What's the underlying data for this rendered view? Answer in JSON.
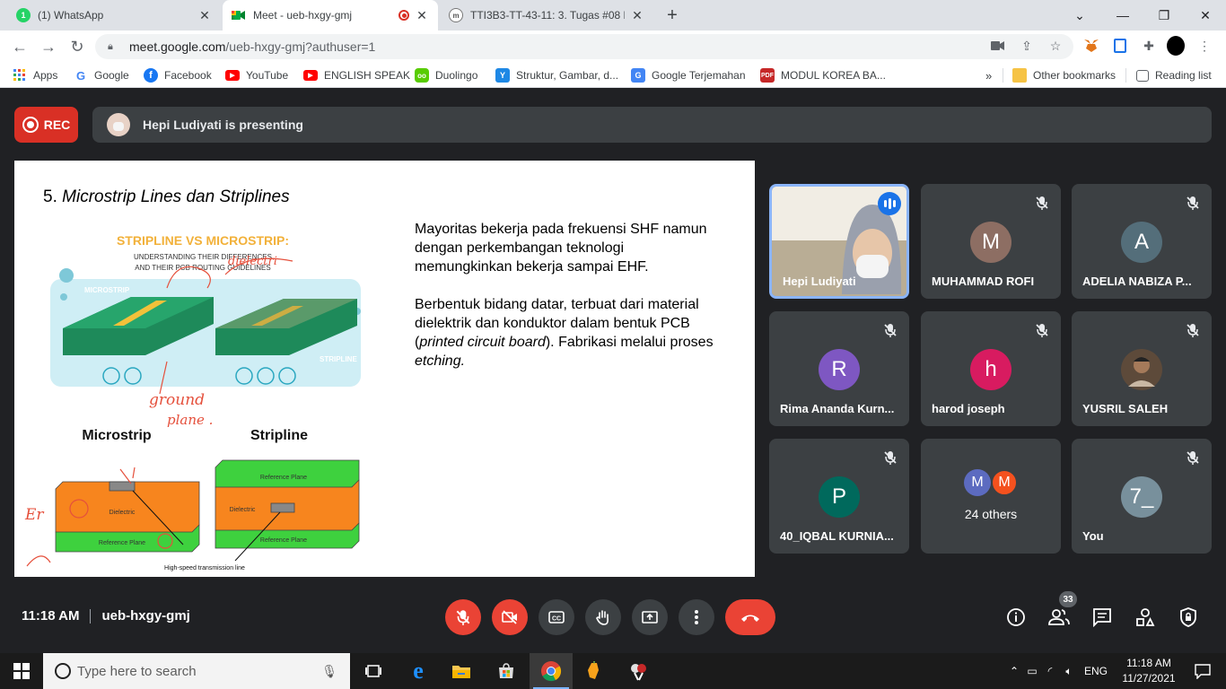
{
  "browser": {
    "tabs": [
      {
        "title": "(1) WhatsApp",
        "icon": "whatsapp-icon"
      },
      {
        "title": "Meet - ueb-hxgy-gmj",
        "icon": "google-meet-icon"
      },
      {
        "title": "TTI3B3-TT-43-11: 3. Tugas #08 P...",
        "icon": "moodle-icon"
      }
    ],
    "new_tab": "+",
    "url_host": "meet.google.com",
    "url_path": "/ueb-hxgy-gmj?authuser=1"
  },
  "bookmarks": [
    {
      "label": "Apps",
      "icon": "apps-grid-icon"
    },
    {
      "label": "Google",
      "icon": "google-icon"
    },
    {
      "label": "Facebook",
      "icon": "facebook-icon"
    },
    {
      "label": "YouTube",
      "icon": "youtube-icon"
    },
    {
      "label": "ENGLISH SPEAK",
      "icon": "youtube-icon"
    },
    {
      "label": "Duolingo",
      "icon": "duolingo-icon"
    },
    {
      "label": "Struktur, Gambar, d...",
      "icon": "yahoo-icon"
    },
    {
      "label": "Google Terjemahan",
      "icon": "translate-icon"
    },
    {
      "label": "MODUL KOREA BA...",
      "icon": "pdf-icon"
    }
  ],
  "bookmarks_overflow": "»",
  "other_bookmarks": "Other bookmarks",
  "reading_list": "Reading list",
  "meet": {
    "rec_label": "REC",
    "presenting": "Hepi Ludiyati is presenting",
    "meeting_time": "11:18 AM",
    "meeting_code": "ueb-hxgy-gmj",
    "participant_count": "33"
  },
  "slide": {
    "number": "5.",
    "title": "Microstrip Lines dan Striplines",
    "paragraph1": "Mayoritas bekerja pada frekuensi SHF namun dengan perkembangan teknologi memungkinkan bekerja sampai EHF.",
    "p2_a": "Berbentuk bidang datar, terbuat dari material dielektrik dan konduktor dalam bentuk PCB (",
    "p2_italic": "printed circuit board",
    "p2_b": "). Fabrikasi melalui proses ",
    "p2_italic2": "etching.",
    "graphic": {
      "heading": "STRIPLINE VS MICROSTRIP:",
      "sub1": "UNDERSTANDING THEIR DIFFERENCES",
      "sub2": "AND THEIR PCB ROUTING GUIDELINES",
      "label_microstrip_tag": "MICROSTRIP",
      "label_stripline_tag": "STRIPLINE",
      "label_microstrip": "Microstrip",
      "label_stripline": "Stripline",
      "dielectric": "Dielectric",
      "reference_plane": "Reference Plane",
      "transmission_line": "High-speed transmission line",
      "hand_ground": "ground",
      "hand_plane": "plane .",
      "hand_dielectric": "dielectri",
      "hand_er": "Er"
    }
  },
  "participants": [
    {
      "name": "Hepi Ludiyati",
      "type": "video"
    },
    {
      "name": "MUHAMMAD ROFI",
      "initial": "M",
      "color": "#8d6e63"
    },
    {
      "name": "ADELIA NABIZA P...",
      "initial": "A",
      "color": "#546e7a"
    },
    {
      "name": "Rima Ananda Kurn...",
      "initial": "R",
      "color": "#7e57c2"
    },
    {
      "name": "harod joseph",
      "initial": "h",
      "color": "#d81b60"
    },
    {
      "name": "YUSRIL SALEH",
      "type": "photo"
    },
    {
      "name": "40_IQBAL KURNIA...",
      "initial": "P",
      "color": "#00695c"
    },
    {
      "name": "24 others",
      "initial_a": "M",
      "initial_b": "M"
    },
    {
      "name": "You",
      "initial": "7_",
      "color": "#78909c"
    }
  ],
  "taskbar": {
    "search_placeholder": "Type here to search",
    "lang": "ENG",
    "time": "11:18 AM",
    "date": "11/27/2021"
  }
}
